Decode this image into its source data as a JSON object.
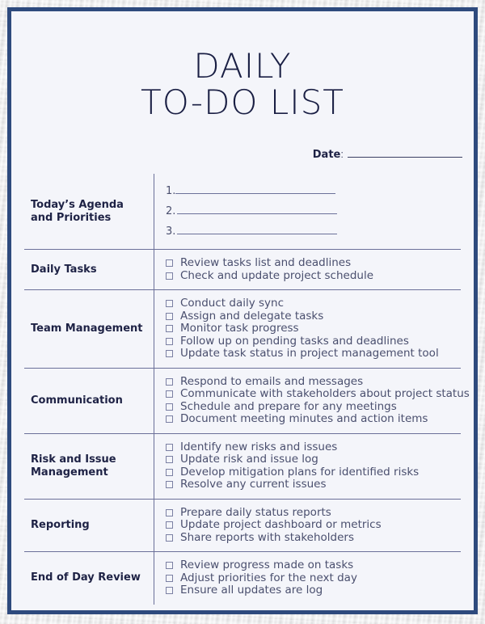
{
  "document": {
    "title_line1": "DAILY",
    "title_line2": "TO-DO LIST",
    "date_label": "Date",
    "date_colon": ":"
  },
  "colors": {
    "frame": "#2e4a7d",
    "page_bg": "#f4f5fa",
    "title_text": "#1a1f44",
    "label_text": "#1e2245",
    "body_text": "#4a4f6e",
    "rule": "#6b7099"
  },
  "sections": [
    {
      "label": "Today’s Agenda and Priorities",
      "type": "numbered",
      "items": [
        {
          "number": "1.",
          "value": ""
        },
        {
          "number": "2.",
          "value": ""
        },
        {
          "number": "3.",
          "value": ""
        }
      ]
    },
    {
      "label": "Daily Tasks",
      "type": "checkbox",
      "items": [
        "Review tasks list and deadlines",
        "Check and update project schedule"
      ]
    },
    {
      "label": "Team Management",
      "type": "checkbox",
      "items": [
        "Conduct daily sync",
        "Assign and delegate tasks",
        "Monitor task progress",
        "Follow up on pending tasks and deadlines",
        "Update task status in project management tool"
      ]
    },
    {
      "label": "Communication",
      "type": "checkbox",
      "items": [
        "Respond to emails and messages",
        "Communicate with stakeholders about project status",
        "Schedule and prepare for any meetings",
        "Document meeting minutes and action items"
      ]
    },
    {
      "label": "Risk and Issue Management",
      "type": "checkbox",
      "items": [
        "Identify new risks and issues",
        "Update risk and issue log",
        "Develop mitigation plans for identified risks",
        "Resolve any current issues"
      ]
    },
    {
      "label": "Reporting",
      "type": "checkbox",
      "items": [
        "Prepare daily status reports",
        "Update project dashboard or metrics",
        "Share reports with stakeholders"
      ]
    },
    {
      "label": "End of Day Review",
      "type": "checkbox",
      "items": [
        "Review progress made on tasks",
        "Adjust priorities for the next day",
        "Ensure all updates are log"
      ]
    }
  ]
}
